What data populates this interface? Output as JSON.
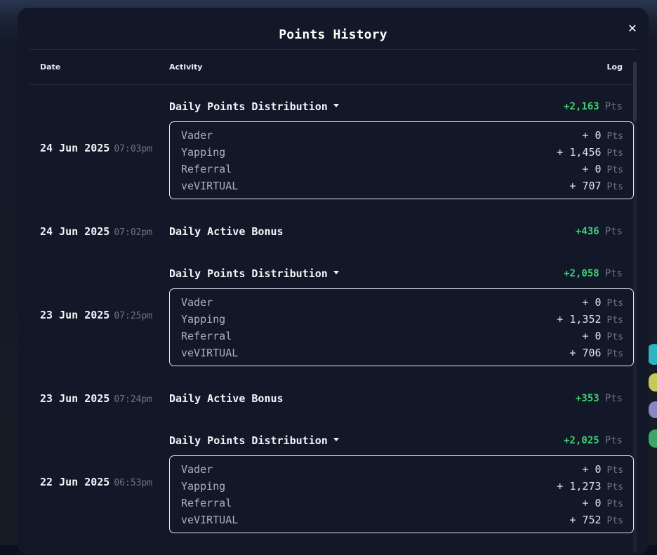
{
  "modal": {
    "title": "Points History",
    "close_glyph": "✕"
  },
  "columns": {
    "date": "Date",
    "activity": "Activity",
    "log": "Log"
  },
  "pts_unit": "Pts",
  "entries": [
    {
      "date": "24 Jun 2025",
      "time": "07:03pm",
      "activity": "Daily Points Distribution",
      "total": "+2,163",
      "breakdown": [
        {
          "name": "Vader",
          "value": "+ 0"
        },
        {
          "name": "Yapping",
          "value": "+ 1,456"
        },
        {
          "name": "Referral",
          "value": "+ 0"
        },
        {
          "name": "veVIRTUAL",
          "value": "+ 707"
        }
      ]
    },
    {
      "date": "24 Jun 2025",
      "time": "07:02pm",
      "activity": "Daily Active Bonus",
      "total": "+436"
    },
    {
      "date": "23 Jun 2025",
      "time": "07:25pm",
      "activity": "Daily Points Distribution",
      "total": "+2,058",
      "breakdown": [
        {
          "name": "Vader",
          "value": "+ 0"
        },
        {
          "name": "Yapping",
          "value": "+ 1,352"
        },
        {
          "name": "Referral",
          "value": "+ 0"
        },
        {
          "name": "veVIRTUAL",
          "value": "+ 706"
        }
      ]
    },
    {
      "date": "23 Jun 2025",
      "time": "07:24pm",
      "activity": "Daily Active Bonus",
      "total": "+353"
    },
    {
      "date": "22 Jun 2025",
      "time": "06:53pm",
      "activity": "Daily Points Distribution",
      "total": "+2,025",
      "breakdown": [
        {
          "name": "Vader",
          "value": "+ 0"
        },
        {
          "name": "Yapping",
          "value": "+ 1,273"
        },
        {
          "name": "Referral",
          "value": "+ 0"
        },
        {
          "name": "veVIRTUAL",
          "value": "+ 752"
        }
      ]
    }
  ],
  "colors": {
    "positive": "#3fcf74",
    "modal_bg": "#121827",
    "muted": "#6b7385"
  }
}
